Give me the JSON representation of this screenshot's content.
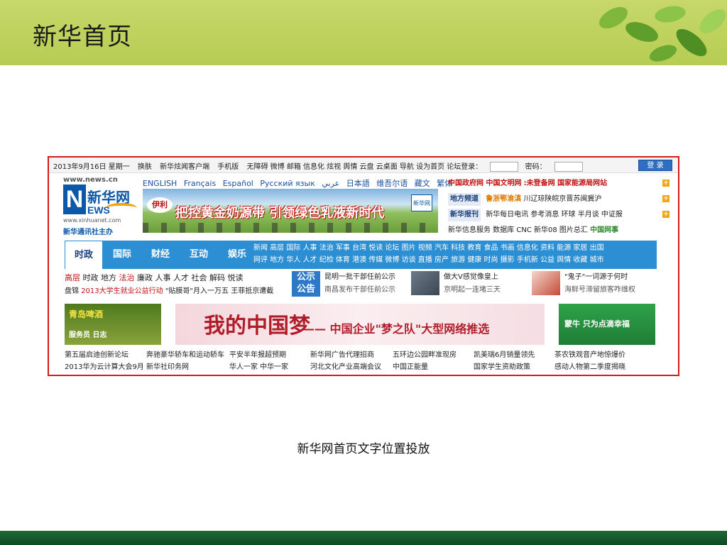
{
  "slide": {
    "title": "新华首页",
    "caption": "新华网首页文字位置投放"
  },
  "site": {
    "topbar": {
      "date": "2013年9月16日 星期一",
      "skin": "换肤",
      "client": "新华炫闻客户端",
      "mobile": "手机版",
      "links": "无障碍 微博 邮箱 信息化 炫视 舆情 云盘 云桌面 导航 设为首页 论坛登录：",
      "password_label": "密码：",
      "login_button": "登 录"
    },
    "logo": {
      "url": "www.news.cn",
      "letter": "N",
      "cn": "新华网",
      "ews": "EWS",
      "site": "www.xinhuanet.com",
      "sub": "新华通讯社主办"
    },
    "languages": [
      "ENGLISH",
      "Français",
      "Español",
      "Русский язык",
      "عربي",
      "日本語",
      "维吾尔语",
      "藏文",
      "繁体"
    ],
    "banner": {
      "brand": "伊利",
      "text": "把控黄金奶源带 引领绿色乳液新时代",
      "logo": "新华网"
    },
    "right_links": {
      "row1_red": "中国政府网 中国文明网",
      "row1_rest": ":未登备网 国家能源局网站",
      "row2_tag": "地方频道",
      "row2_orange": "鲁浙鄂渝滇",
      "row2_rest": "川辽琼陕皖京晋苏闽冀沪",
      "row3_tag": "新华报刊",
      "row3_rest": "新华每日电讯 参考消息 环球 半月谈 中证报",
      "row4": "新华信息服务 数据库 CNC 新华08 图片总汇",
      "row4_green": "中国网事",
      "plus": "+"
    },
    "nav": {
      "tabs": [
        "时政",
        "国际",
        "财经",
        "互动",
        "娱乐"
      ],
      "links_row1": "新闻 高层 国际 人事 法治 军事 台湾 悦读 论坛 图片 视频 汽车 科技 教育 食品 书画 信息化 资料 能源 家居 出国",
      "links_row2": "网评 地方 华人 人才 纪检 体育 港澳 传媒 微博 访谈 直播 房产 旅游 健康 时尚 摄影 手机新 公益 舆情 收藏 城市"
    },
    "news_left": {
      "row1_red1": "高层",
      "row1_mid": " 时政 地方 ",
      "row1_red2": "法治",
      "row1_rest": " 廉政 人事 人才 社会 解码 悦读",
      "row2_label": "盘锦 ",
      "row2_red": "2013大学生就业公益行动",
      "row2_rest": " \"贴膜哥\"月入一万五 王菲抵京遭截"
    },
    "notice": {
      "box": "公示\n公告",
      "line1": "昆明一批干部任前公示",
      "line2": "南昌发布干部任前公示"
    },
    "thumb1": {
      "line1": "做大V感觉像皇上",
      "line2": "京明起一连堵三天"
    },
    "thumb2": {
      "line1": "\"鬼子\"一词源于何时",
      "line2": "海鲜号滞留旅客咋维权"
    },
    "ads": {
      "beer": "青岛啤酒",
      "beer_sub": "服务员 日志",
      "dream_cn": "我的中国梦",
      "dream_text": "—— 中国企业\"梦之队\"大型网络推选",
      "mengniu": "蒙牛 只为点滴幸福"
    },
    "bottom_links": {
      "row1": [
        "第五届启迪创新论坛",
        "奔驰豪华轿车和运动轿车",
        "平安半年报超预期",
        "新华网广告代理招商",
        "五环边公园畔准现房",
        "凯美瑞6月销量领先",
        "茶农铁观音产地惊爆价"
      ],
      "row2": [
        "2013华为云计算大会9月",
        "新华社印务网",
        "华人一家 中华一家",
        "河北文化产业高端会议",
        "中国正能量",
        "国家学生资助政策",
        "感动人物第二季度揭晓"
      ]
    }
  }
}
